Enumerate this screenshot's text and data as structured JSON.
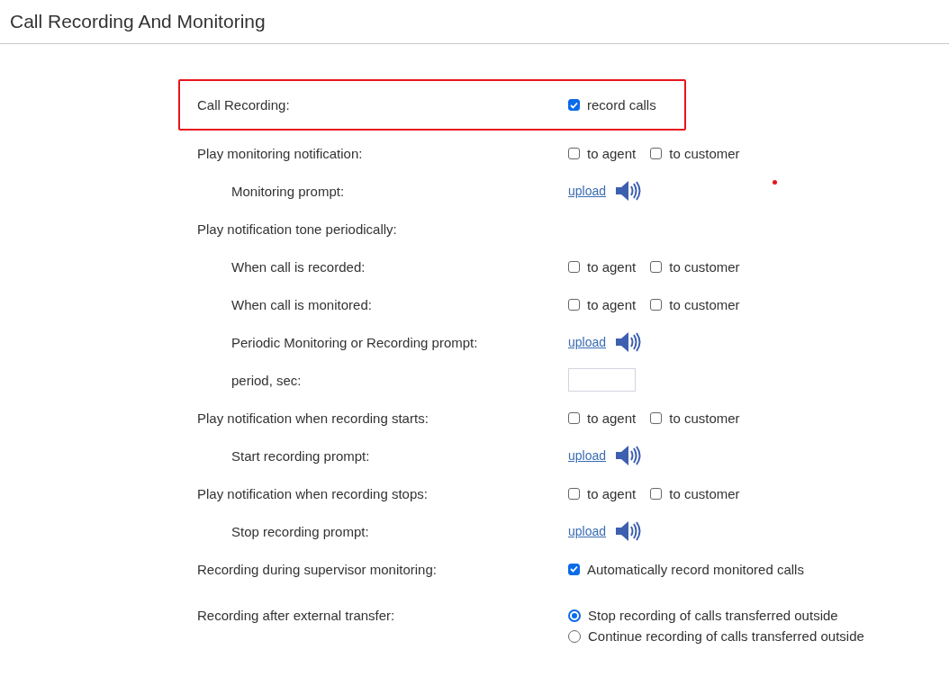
{
  "header": {
    "title": "Call Recording And Monitoring"
  },
  "rows": [
    {
      "label": "Call Recording:",
      "indented": false,
      "highlighted": true,
      "kind": "checkboxes",
      "options": [
        {
          "label": "record calls",
          "checked": true
        }
      ]
    },
    {
      "label": "Play monitoring notification:",
      "indented": false,
      "highlighted": false,
      "kind": "checkboxes",
      "options": [
        {
          "label": "to agent",
          "checked": false
        },
        {
          "label": "to customer",
          "checked": false
        }
      ]
    },
    {
      "label": "Monitoring prompt:",
      "indented": true,
      "highlighted": false,
      "kind": "upload",
      "link": "upload"
    },
    {
      "label": "Play notification tone periodically:",
      "indented": false,
      "highlighted": false,
      "kind": "heading"
    },
    {
      "label": "When call is recorded:",
      "indented": true,
      "highlighted": false,
      "kind": "checkboxes",
      "options": [
        {
          "label": "to agent",
          "checked": false
        },
        {
          "label": "to customer",
          "checked": false
        }
      ]
    },
    {
      "label": "When call is monitored:",
      "indented": true,
      "highlighted": false,
      "kind": "checkboxes",
      "options": [
        {
          "label": "to agent",
          "checked": false
        },
        {
          "label": "to customer",
          "checked": false
        }
      ]
    },
    {
      "label": "Periodic Monitoring or Recording prompt:",
      "indented": true,
      "highlighted": false,
      "kind": "upload",
      "link": "upload"
    },
    {
      "label": "period, sec:",
      "indented": true,
      "highlighted": false,
      "kind": "input"
    },
    {
      "label": "Play notification when recording starts:",
      "indented": false,
      "highlighted": false,
      "kind": "checkboxes",
      "options": [
        {
          "label": "to agent",
          "checked": false
        },
        {
          "label": "to customer",
          "checked": false
        }
      ]
    },
    {
      "label": "Start recording prompt:",
      "indented": true,
      "highlighted": false,
      "kind": "upload",
      "link": "upload"
    },
    {
      "label": "Play notification when recording stops:",
      "indented": false,
      "highlighted": false,
      "kind": "checkboxes",
      "options": [
        {
          "label": "to agent",
          "checked": false
        },
        {
          "label": "to customer",
          "checked": false
        }
      ]
    },
    {
      "label": "Stop recording prompt:",
      "indented": true,
      "highlighted": false,
      "kind": "upload",
      "link": "upload"
    },
    {
      "label": "Recording during supervisor monitoring:",
      "indented": false,
      "highlighted": false,
      "kind": "checkboxes",
      "options": [
        {
          "label": "Automatically record monitored calls",
          "checked": true
        }
      ]
    },
    {
      "label": "Recording after external transfer:",
      "indented": false,
      "highlighted": false,
      "kind": "radios",
      "options": [
        {
          "label": "Stop recording of calls transferred outside",
          "selected": true
        },
        {
          "label": "Continue recording of calls transferred outside",
          "selected": false
        }
      ]
    }
  ]
}
